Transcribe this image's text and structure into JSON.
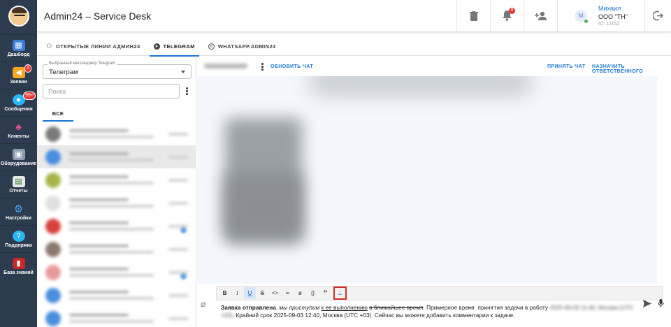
{
  "header": {
    "title": "Admin24 – Service Desk",
    "notifications_count": "8",
    "user": {
      "avatar_letter": "М",
      "name": "Михаил",
      "company": "ООО \"ТН\"",
      "id": "ID: 12152"
    }
  },
  "sidebar": {
    "items": [
      {
        "label": "Дашборд",
        "icon": "dashboard-icon",
        "badge": ""
      },
      {
        "label": "Заявки",
        "icon": "megaphone-icon",
        "badge": "2"
      },
      {
        "label": "Сообщения",
        "icon": "chat-bubbles-icon",
        "badge": "99+"
      },
      {
        "label": "Клиенты",
        "icon": "clients-icon",
        "badge": ""
      },
      {
        "label": "Оборудование",
        "icon": "equipment-icon",
        "badge": ""
      },
      {
        "label": "Отчеты",
        "icon": "report-icon",
        "badge": ""
      },
      {
        "label": "Настройки",
        "icon": "gear-icon",
        "badge": ""
      },
      {
        "label": "Поддержка",
        "icon": "help-icon",
        "badge": ""
      },
      {
        "label": "База знаний",
        "icon": "knowledge-base-icon",
        "badge": ""
      }
    ]
  },
  "tabs": [
    {
      "label": "ОТКРЫТЫЕ ЛИНИИ АДМИН24",
      "icon": "users-icon",
      "active": false
    },
    {
      "label": "TELEGRAM",
      "icon": "telegram-icon",
      "active": true
    },
    {
      "label": "WHATSAPP.ADMIN24",
      "icon": "whatsapp-icon",
      "active": false
    }
  ],
  "messenger_select": {
    "legend": "Выбранный мессенджер Telegram",
    "value": "Телеграм"
  },
  "search": {
    "placeholder": "Поиск"
  },
  "subtabs": {
    "all_label": "ВСЕ"
  },
  "chat_toolbar": {
    "refresh_label": "ОБНОВИТЬ ЧАТ",
    "accept_label": "ПРИНЯТЬ ЧАТ",
    "assign_label": "НАЗНАЧИТЬ ОТВЕТСТВЕННОГО"
  },
  "format_buttons": [
    {
      "label": "B",
      "name": "bold-button"
    },
    {
      "label": "I",
      "name": "italic-button"
    },
    {
      "label": "U",
      "name": "underline-button"
    },
    {
      "label": "S",
      "name": "strikethrough-button"
    },
    {
      "label": "<>",
      "name": "code-button"
    },
    {
      "label": "∞",
      "name": "link-button"
    },
    {
      "label": "ø",
      "name": "spoiler-button"
    },
    {
      "label": "{}",
      "name": "code-block-button"
    },
    {
      "label": "”",
      "name": "quote-button"
    },
    {
      "label": "⊥",
      "name": "pin-button"
    }
  ],
  "composer": {
    "bold": "Заявка отправлена",
    "comma": ", ",
    "italic": "мы приступим",
    "space1": " ",
    "underline": "к ее выполнению",
    "space2": " ",
    "strike": "в ближайшее время",
    "after_strike": ". Примерное ",
    "mono": "время принятия",
    "after_mono": " задачи в работу ",
    "blurred": "2025-09-03 11:40, Москва (UTC +03)",
    "tail": ". Крайний срок 2025-09-03 12:40, Москва (UTC +03). Сейчас вы можете добавить комментарии к задаче."
  },
  "colors": {
    "sidebar_bg": "#2c3b4d",
    "accent": "#1976d2",
    "badge": "#e53935",
    "messages_bg": "#f4f7fc"
  }
}
